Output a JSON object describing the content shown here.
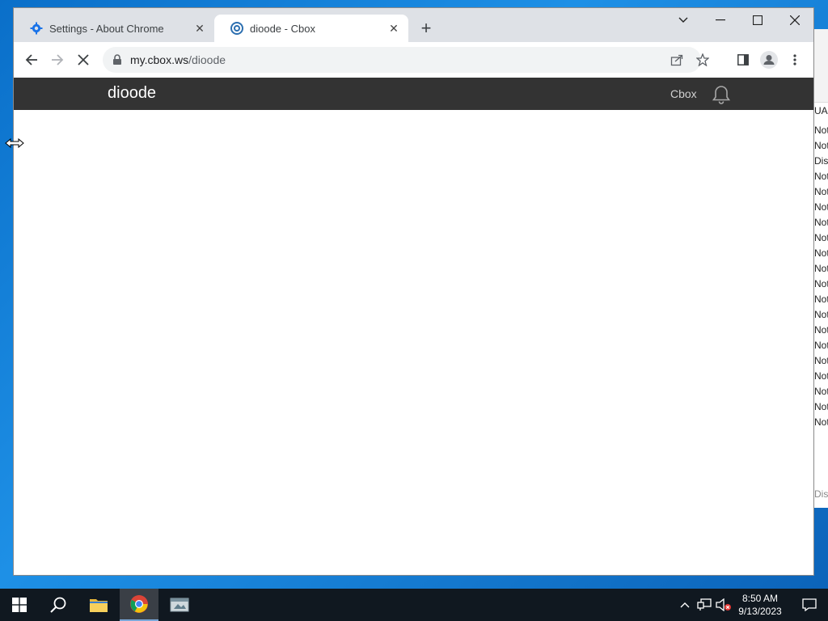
{
  "tabs": [
    {
      "title": "Settings - About Chrome"
    },
    {
      "title": "dioode - Cbox"
    }
  ],
  "address_bar": {
    "host": "my.cbox.ws",
    "path": "/dioode"
  },
  "site": {
    "title": "dioode",
    "nav_link": "Cbox"
  },
  "background_window": {
    "header": "UAC",
    "rows": [
      "Not",
      "Not",
      "Disa",
      "Not",
      "Not",
      "Not",
      "Not",
      "Not",
      "Not",
      "Not",
      "Not",
      "Not",
      "Not",
      "Not",
      "Not",
      "Not",
      "Not",
      "Not",
      "Not",
      "Not"
    ],
    "footer": "Disa"
  },
  "taskbar": {
    "time": "8:50 AM",
    "date": "9/13/2023"
  },
  "colors": {
    "site_header_bg": "#333333",
    "tabstrip_bg": "#dee1e6",
    "taskbar_bg": "#101820"
  }
}
